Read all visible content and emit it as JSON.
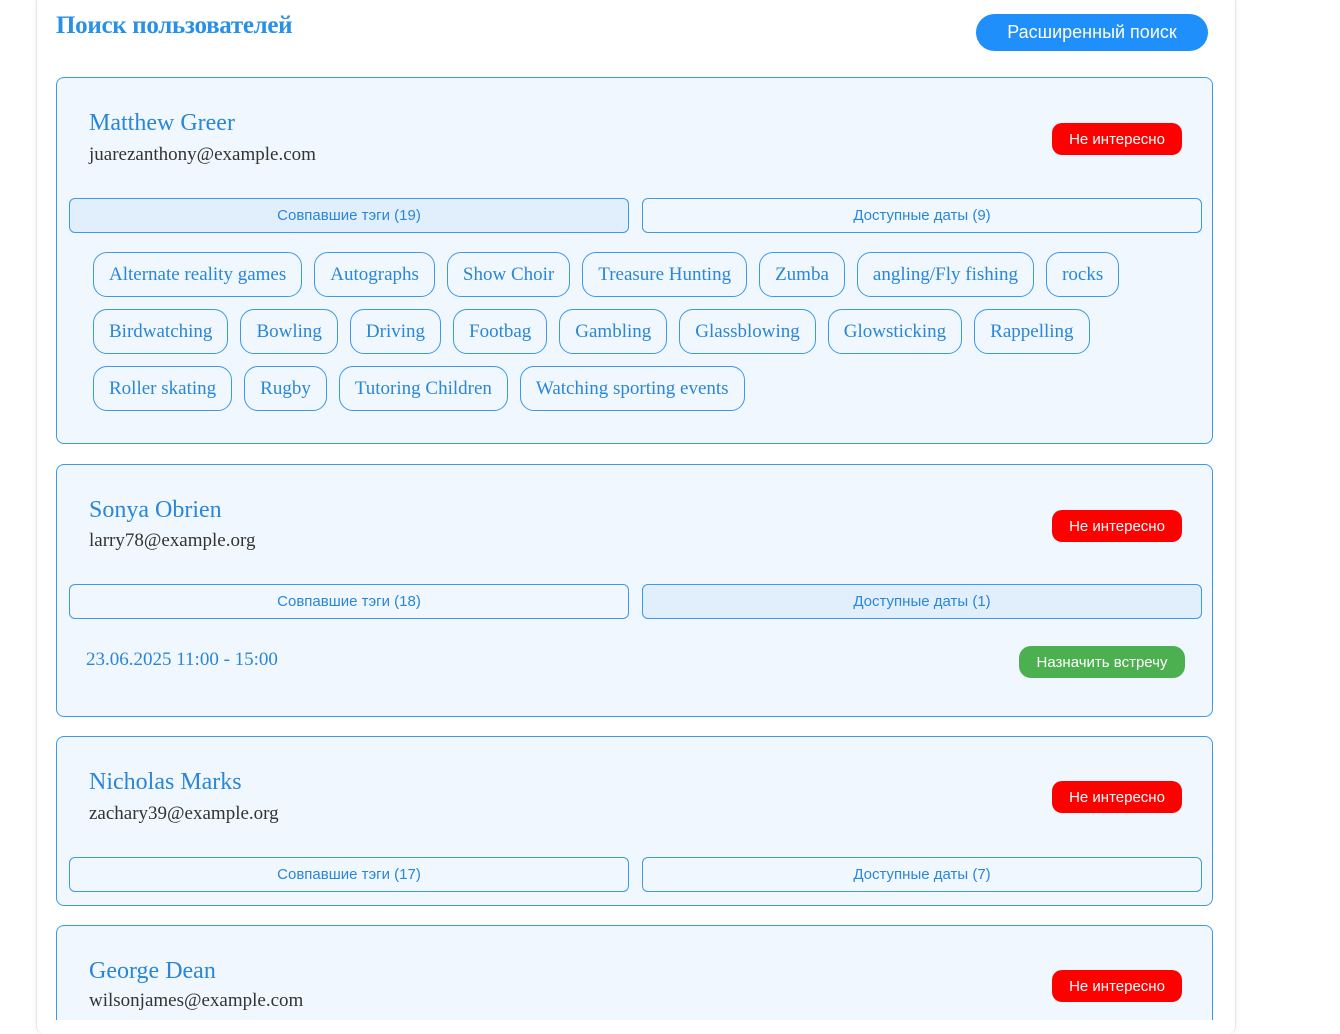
{
  "header": {
    "title": "Поиск пользователей",
    "advanced_search_label": "Расширенный поиск"
  },
  "colors": {
    "accent": "#2a86d9",
    "primary_button": "#1e8ffb",
    "reject_button": "#ff0000",
    "schedule_button": "#4caf50",
    "card_background": "#f0f7fe"
  },
  "labels": {
    "reject": "Не интересно",
    "schedule": "Назначить встречу"
  },
  "users": [
    {
      "name": "Matthew Greer",
      "email": "juarezanthony@example.com",
      "tags_tab": "Совпавшие тэги (19)",
      "dates_tab": "Доступные даты (9)",
      "active_tab": "tags",
      "tags": [
        "Alternate reality games",
        "Autographs",
        "Show Choir",
        "Treasure Hunting",
        "Zumba",
        "angling/Fly fishing",
        "rocks",
        "Birdwatching",
        "Bowling",
        "Driving",
        "Footbag",
        "Gambling",
        "Glassblowing",
        "Glowsticking",
        "Rappelling",
        "Roller skating",
        "Rugby",
        "Tutoring Children",
        "Watching sporting events"
      ]
    },
    {
      "name": "Sonya Obrien",
      "email": "larry78@example.org",
      "tags_tab": "Совпавшие тэги (18)",
      "dates_tab": "Доступные даты (1)",
      "active_tab": "dates",
      "slot": "23.06.2025 11:00 - 15:00"
    },
    {
      "name": "Nicholas Marks",
      "email": "zachary39@example.org",
      "tags_tab": "Совпавшие тэги (17)",
      "dates_tab": "Доступные даты (7)",
      "active_tab": "none"
    },
    {
      "name": "George Dean",
      "email": "wilsonjames@example.com"
    }
  ]
}
